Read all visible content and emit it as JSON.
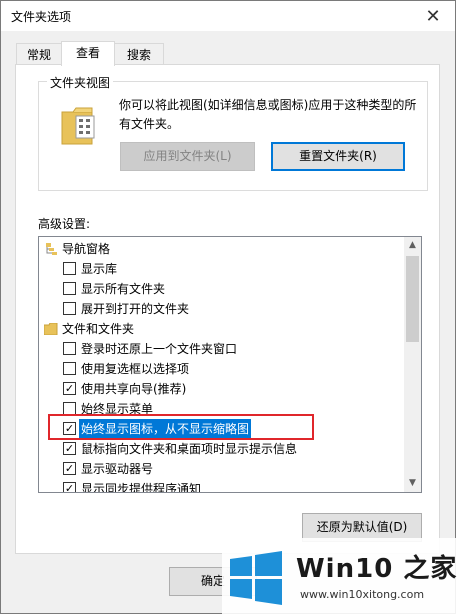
{
  "window": {
    "title": "文件夹选项",
    "close_glyph": "✕"
  },
  "tabs": [
    {
      "label": "常规",
      "active": false
    },
    {
      "label": "查看",
      "active": true
    },
    {
      "label": "搜索",
      "active": false
    }
  ],
  "folder_views": {
    "legend": "文件夹视图",
    "description": "你可以将此视图(如详细信息或图标)应用于这种类型的所有文件夹。",
    "apply_button": "应用到文件夹(L)",
    "reset_button": "重置文件夹(R)"
  },
  "advanced": {
    "label": "高级设置:",
    "items": [
      {
        "type": "group",
        "icon": "navigation-pane-icon",
        "label": "导航窗格"
      },
      {
        "type": "check",
        "checked": false,
        "label": "显示库"
      },
      {
        "type": "check",
        "checked": false,
        "label": "显示所有文件夹"
      },
      {
        "type": "check",
        "checked": false,
        "label": "展开到打开的文件夹"
      },
      {
        "type": "group",
        "icon": "folder-icon",
        "label": "文件和文件夹"
      },
      {
        "type": "check",
        "checked": false,
        "label": "登录时还原上一个文件夹窗口"
      },
      {
        "type": "check",
        "checked": false,
        "label": "使用复选框以选择项"
      },
      {
        "type": "check",
        "checked": true,
        "label": "使用共享向导(推荐)"
      },
      {
        "type": "check",
        "checked": false,
        "label": "始终显示菜单"
      },
      {
        "type": "check",
        "checked": true,
        "label": "始终显示图标，从不显示缩略图",
        "selected": true
      },
      {
        "type": "check",
        "checked": true,
        "label": "鼠标指向文件夹和桌面项时显示提示信息"
      },
      {
        "type": "check",
        "checked": true,
        "label": "显示驱动器号"
      },
      {
        "type": "check",
        "checked": true,
        "label": "显示同步提供程序通知"
      }
    ],
    "restore_button": "还原为默认值(D)"
  },
  "footer": {
    "ok_button": "确定"
  },
  "watermark": {
    "title": "Win10 之家",
    "url": "www.win10xitong.com",
    "colors": {
      "logo": "#1e90d8",
      "text": "#1a1a1a"
    }
  }
}
